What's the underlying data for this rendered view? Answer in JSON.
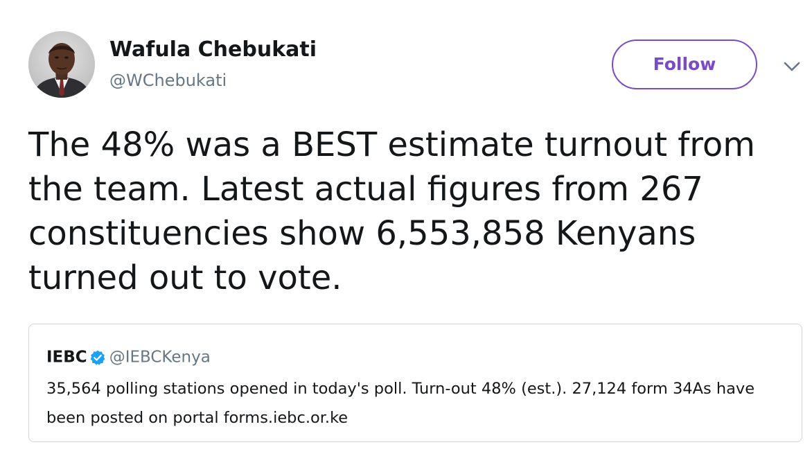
{
  "author": {
    "display_name": "Wafula Chebukati",
    "handle": "@WChebukati"
  },
  "follow_button": {
    "label": "Follow"
  },
  "icons": {
    "menu": "chevron-down-icon",
    "verified": "verified-badge-icon",
    "avatar": "profile-photo"
  },
  "tweet": {
    "text": "The 48% was a BEST estimate turnout from the team. Latest actual figures from 267 constituencies show 6,553,858 Kenyans turned out to vote."
  },
  "quoted_tweet": {
    "author_name": "IEBC",
    "author_handle": "@IEBCKenya",
    "verified": true,
    "text": "35,564 polling stations opened in today's poll. Turn-out 48% (est.). 27,124 form 34As have been posted on portal forms.iebc.or.ke"
  },
  "colors": {
    "accent": "#794bc4",
    "text_primary": "#14171a",
    "text_secondary": "#657786",
    "border": "#ccd6dd",
    "verified_blue": "#1da1f2"
  }
}
